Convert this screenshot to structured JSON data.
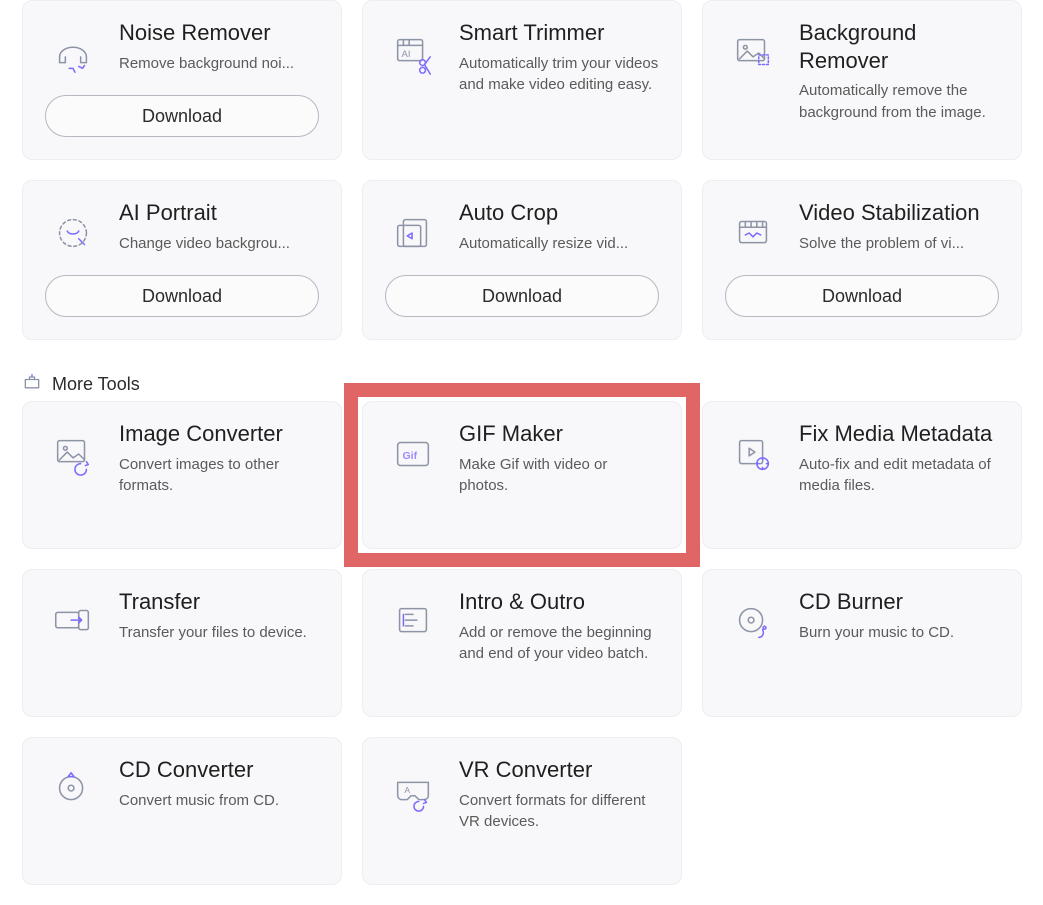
{
  "section1": {
    "cards": [
      {
        "title": "Noise Remover",
        "desc": "Remove background noi...",
        "truncate": true,
        "download": true
      },
      {
        "title": "Smart Trimmer",
        "desc": "Automatically trim your videos and make video editing easy.",
        "truncate": false,
        "download": false
      },
      {
        "title": "Background Remover",
        "desc": "Automatically remove the background from the image.",
        "truncate": false,
        "download": false
      },
      {
        "title": "AI Portrait",
        "desc": "Change video backgrou...",
        "truncate": true,
        "download": true
      },
      {
        "title": "Auto Crop",
        "desc": "Automatically resize vid...",
        "truncate": true,
        "download": true
      },
      {
        "title": "Video Stabilization",
        "desc": "Solve the problem of vi...",
        "truncate": true,
        "download": true
      }
    ]
  },
  "section2": {
    "header": "More Tools",
    "cards": [
      {
        "title": "Image Converter",
        "desc": "Convert images to other formats."
      },
      {
        "title": "GIF Maker",
        "desc": "Make Gif with video or photos.",
        "highlighted": true
      },
      {
        "title": "Fix Media Metadata",
        "desc": "Auto-fix and edit metadata of media files."
      },
      {
        "title": "Transfer",
        "desc": "Transfer your files to device."
      },
      {
        "title": "Intro & Outro",
        "desc": "Add or remove the beginning and end of your video batch."
      },
      {
        "title": "CD Burner",
        "desc": "Burn your music to CD."
      },
      {
        "title": "CD Converter",
        "desc": "Convert music from CD."
      },
      {
        "title": "VR Converter",
        "desc": "Convert formats for different VR devices."
      }
    ]
  },
  "download_label": "Download"
}
